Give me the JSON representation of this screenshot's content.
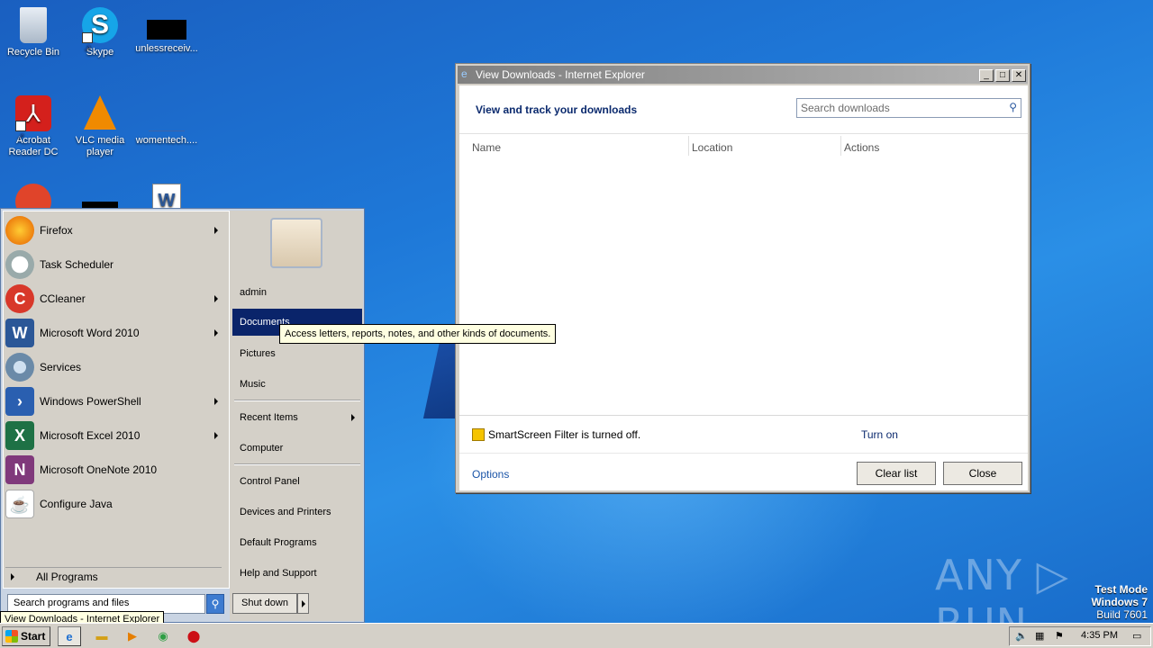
{
  "desktop": {
    "icons": [
      {
        "label": "Recycle Bin",
        "icon": "recycle-bin-icon"
      },
      {
        "label": "Skype",
        "icon": "skype-icon"
      },
      {
        "label": "unlessreceiv...",
        "icon": "file-icon"
      },
      {
        "label": "Acrobat Reader DC",
        "icon": "acrobat-icon"
      },
      {
        "label": "VLC media player",
        "icon": "vlc-icon"
      },
      {
        "label": "womentech....",
        "icon": "file-icon"
      }
    ]
  },
  "start_menu": {
    "programs": [
      {
        "label": "Firefox",
        "icon": "firefox-icon",
        "submenu": true
      },
      {
        "label": "Task Scheduler",
        "icon": "task-scheduler-icon",
        "submenu": false
      },
      {
        "label": "CCleaner",
        "icon": "ccleaner-icon",
        "submenu": true
      },
      {
        "label": "Microsoft Word 2010",
        "icon": "word-icon",
        "submenu": true
      },
      {
        "label": "Services",
        "icon": "services-icon",
        "submenu": false
      },
      {
        "label": "Windows PowerShell",
        "icon": "powershell-icon",
        "submenu": true
      },
      {
        "label": "Microsoft Excel 2010",
        "icon": "excel-icon",
        "submenu": true
      },
      {
        "label": "Microsoft OneNote 2010",
        "icon": "onenote-icon",
        "submenu": false
      },
      {
        "label": "Configure Java",
        "icon": "java-icon",
        "submenu": false
      }
    ],
    "all_programs": "All Programs",
    "search_placeholder": "Search programs and files",
    "right_items": [
      {
        "label": "admin"
      },
      {
        "label": "Documents",
        "selected": true
      },
      {
        "label": "Pictures"
      },
      {
        "label": "Music"
      },
      {
        "label": "Recent Items",
        "submenu": true
      },
      {
        "label": "Computer"
      },
      {
        "label": "Control Panel"
      },
      {
        "label": "Devices and Printers"
      },
      {
        "label": "Default Programs"
      },
      {
        "label": "Help and Support"
      }
    ],
    "shutdown_label": "Shut down",
    "tooltip": "Access letters, reports, notes, and other kinds of documents."
  },
  "taskbar_tooltip": "View Downloads - Internet Explorer",
  "dialog": {
    "title": "View Downloads - Internet Explorer",
    "heading": "View and track your downloads",
    "search_placeholder": "Search downloads",
    "columns": [
      "Name",
      "Location",
      "Actions"
    ],
    "smartscreen_text": "SmartScreen Filter is turned off.",
    "turn_on": "Turn on",
    "options": "Options",
    "clear_list": "Clear list",
    "close": "Close"
  },
  "watermark": "ANY ▷ RUN",
  "test_mode": {
    "line1": "Test Mode",
    "line2": "Windows 7",
    "line3": "Build 7601"
  },
  "taskbar": {
    "start_label": "Start",
    "clock": "4:35 PM"
  }
}
